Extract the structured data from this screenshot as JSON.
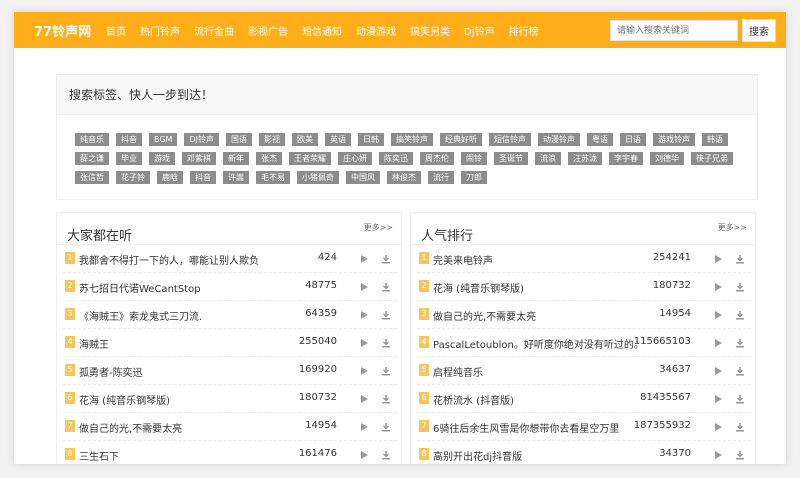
{
  "header": {
    "logo": "77铃声网",
    "nav": [
      "首页",
      "热门铃声",
      "流行金曲",
      "影视广告",
      "短信通知",
      "动漫游戏",
      "搞笑另类",
      "DJ铃声",
      "排行榜"
    ],
    "search_placeholder": "请输入搜索关键词",
    "search_button": "搜索"
  },
  "tags_section": {
    "title": "搜索标签、快人一步到达！",
    "tags": [
      "纯音乐",
      "抖音",
      "BGM",
      "DJ铃声",
      "国语",
      "影视",
      "欧美",
      "英语",
      "日韩",
      "搞笑铃声",
      "经典好听",
      "短信铃声",
      "动漫铃声",
      "粤语",
      "日语",
      "游戏铃声",
      "韩语",
      "薛之谦",
      "毕业",
      "游戏",
      "邓紫棋",
      "新年",
      "张杰",
      "王者荣耀",
      "庄心妍",
      "陈奕迅",
      "周杰伦",
      "闹铃",
      "圣诞节",
      "流浪",
      "汪苏泷",
      "李宇春",
      "刘德华",
      "筷子兄弟",
      "张信哲",
      "花子铃",
      "鹿晗",
      "抖音",
      "许嵩",
      "毛不易",
      "小猪佩奇",
      "中国风",
      "林俊杰",
      "流行",
      "刀郎"
    ]
  },
  "left_panel": {
    "title": "大家都在听",
    "more": "更多>>",
    "rows": [
      {
        "rank": "1",
        "title": "我都舍不得打一下的人，哪能让别人欺负",
        "count": "424"
      },
      {
        "rank": "2",
        "title": "苏七招日代诺WeCantStop",
        "count": "48775"
      },
      {
        "rank": "3",
        "title": "《海贼王》索龙鬼式三刀流.",
        "count": "64359"
      },
      {
        "rank": "4",
        "title": "海贼王",
        "count": "255040"
      },
      {
        "rank": "5",
        "title": "孤勇者-陈奕迅",
        "count": "169920"
      },
      {
        "rank": "6",
        "title": "花海 (纯音乐钢琴版)",
        "count": "180732"
      },
      {
        "rank": "7",
        "title": "做自己的光,不需要太亮",
        "count": "14954"
      },
      {
        "rank": "8",
        "title": "三生石下",
        "count": "161476"
      }
    ]
  },
  "right_panel": {
    "title": "人气排行",
    "more": "更多>>",
    "rows": [
      {
        "rank": "1",
        "title": "完美来电铃声",
        "count": "254241"
      },
      {
        "rank": "2",
        "title": "花海 (纯音乐钢琴版)",
        "count": "180732"
      },
      {
        "rank": "3",
        "title": "做自己的光,不需要太亮",
        "count": "14954"
      },
      {
        "rank": "4",
        "title": "PascalLetoublon。好听度你绝对没有听过的。",
        "count": "115665103"
      },
      {
        "rank": "5",
        "title": "启程纯音乐",
        "count": "34637"
      },
      {
        "rank": "6",
        "title": "花桥流水 (抖音版)",
        "count": "81435567"
      },
      {
        "rank": "7",
        "title": "6骑往后余生风雪是你想带你去看星空万里",
        "count": "187355932"
      },
      {
        "rank": "8",
        "title": "高别开出花dj抖音版",
        "count": "34370"
      }
    ]
  },
  "colors": {
    "header_bg": "#ffae1a",
    "tag_bg": "#8c8c8c",
    "rank_badge": "#f5c55e"
  },
  "icons": {
    "play": "play-icon",
    "download": "download-icon"
  }
}
